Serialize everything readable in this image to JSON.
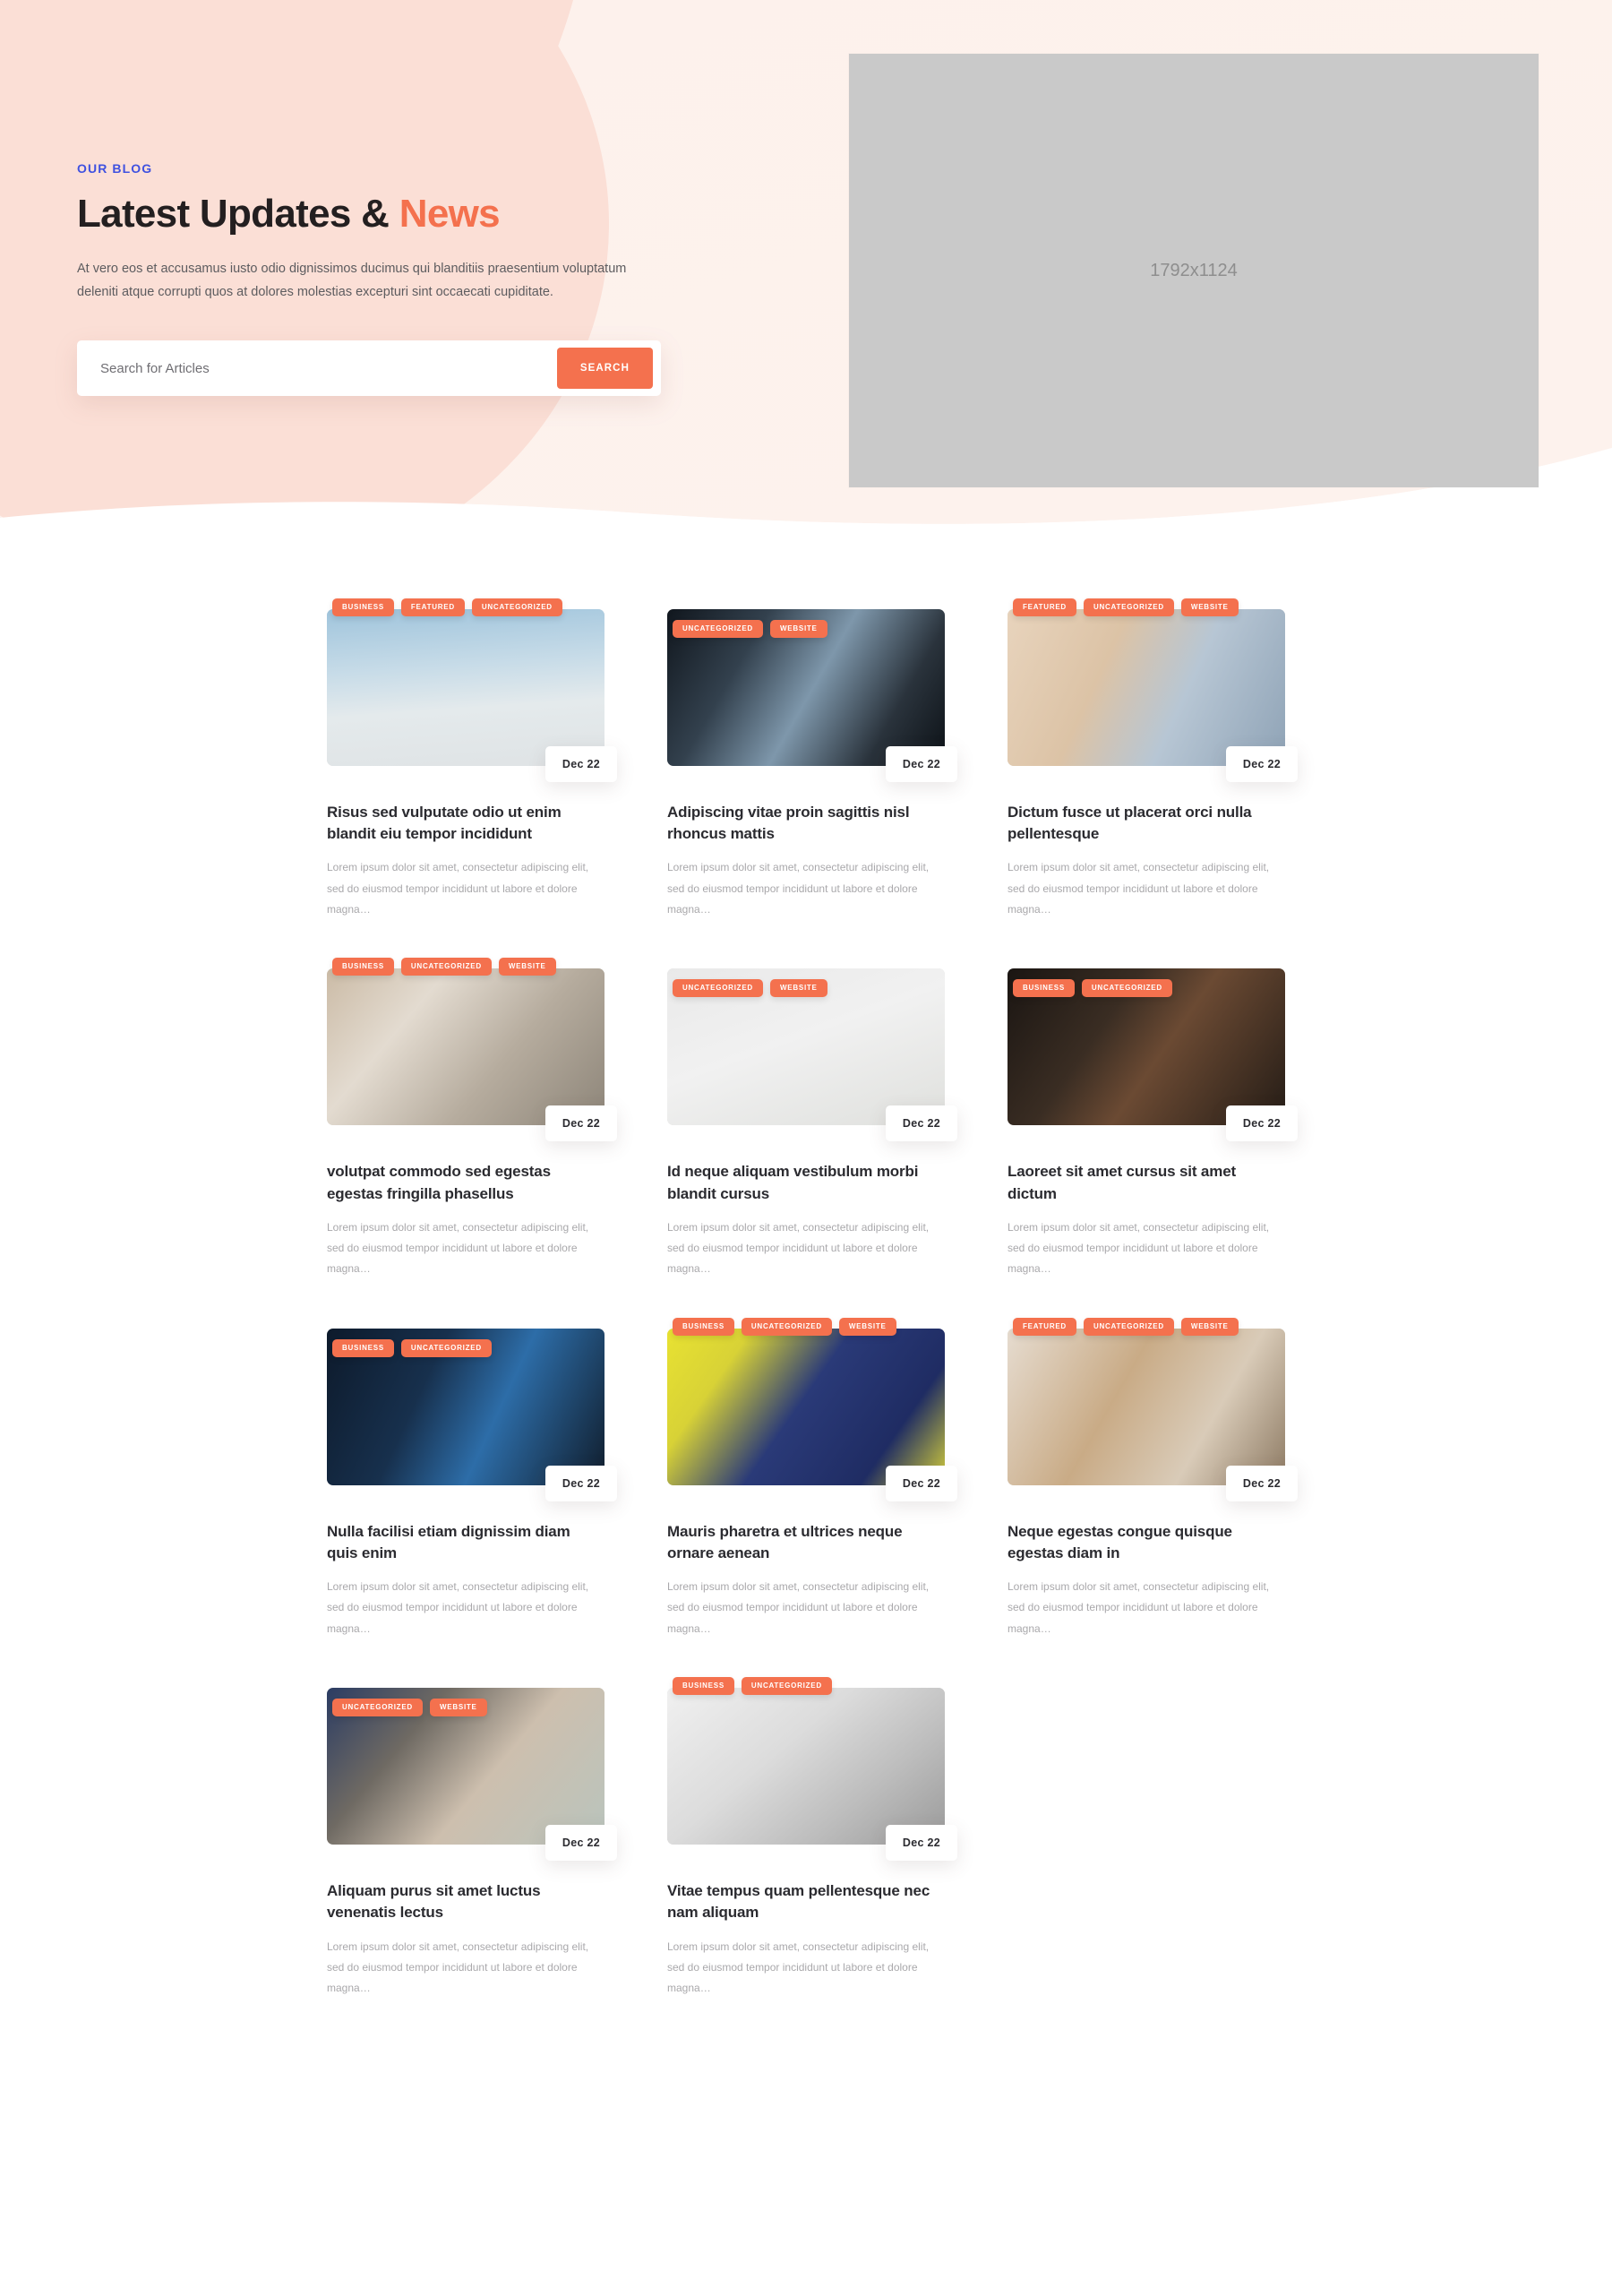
{
  "hero": {
    "eyebrow": "OUR BLOG",
    "title_main": "Latest Updates & ",
    "title_accent": "News",
    "subtitle": "At vero eos et accusamus iusto odio dignissimos ducimus qui blanditiis praesentium voluptatum deleniti atque corrupti quos at dolores molestias excepturi sint occaecati cupiditate.",
    "search_placeholder": "Search for Articles",
    "search_value": "",
    "search_button": "SEARCH",
    "image_placeholder_label": "1792x1124",
    "colors": {
      "accent": "#f4714e",
      "eyebrow": "#3f51e0",
      "hero_bg_light": "#fdf0eb",
      "hero_bg_blob": "#fbdfd6",
      "heading": "#231f20",
      "body_text": "#5d5c5f",
      "placeholder_bg": "#c9c9c9"
    }
  },
  "posts": [
    {
      "tags": [
        "BUSINESS",
        "FEATURED",
        "UNCATEGORIZED"
      ],
      "tags_overhang": true,
      "date": "Dec 22",
      "title": "Risus sed vulputate odio ut enim blandit eiu tempor incididunt",
      "excerpt": "Lorem ipsum dolor sit amet, consectetur adipiscing elit, sed do eiusmod tempor incididunt ut labore et dolore magna…",
      "image": "p-clouds",
      "column": 0
    },
    {
      "tags": [
        "UNCATEGORIZED",
        "WEBSITE"
      ],
      "tags_overhang": false,
      "date": "Dec 22",
      "title": "Adipiscing vitae proin sagittis nisl rhoncus mattis",
      "excerpt": "Lorem ipsum dolor sit amet, consectetur adipiscing elit, sed do eiusmod tempor incididunt ut labore et dolore magna…",
      "image": "p-towers",
      "column": 1
    },
    {
      "tags": [
        "FEATURED",
        "UNCATEGORIZED",
        "WEBSITE"
      ],
      "tags_overhang": true,
      "date": "Dec 22",
      "title": "Dictum fusce ut placerat orci nulla pellentesque",
      "excerpt": "Lorem ipsum dolor sit amet, consectetur adipiscing elit, sed do eiusmod tempor incididunt ut labore et dolore magna…",
      "image": "p-tablet",
      "column": 2
    },
    {
      "tags": [
        "BUSINESS",
        "UNCATEGORIZED",
        "WEBSITE"
      ],
      "tags_overhang": true,
      "date": "Dec 22",
      "title": "volutpat commodo sed egestas egestas fringilla phasellus",
      "excerpt": "Lorem ipsum dolor sit amet, consectetur adipiscing elit, sed do eiusmod tempor incididunt ut labore et dolore magna…",
      "image": "p-desk",
      "column": 0
    },
    {
      "tags": [
        "UNCATEGORIZED",
        "WEBSITE"
      ],
      "tags_overhang": false,
      "date": "Dec 22",
      "title": "Id neque aliquam vestibulum morbi blandit cursus",
      "excerpt": "Lorem ipsum dolor sit amet, consectetur adipiscing elit, sed do eiusmod tempor incididunt ut labore et dolore magna…",
      "image": "p-flat",
      "column": 1
    },
    {
      "tags": [
        "BUSINESS",
        "UNCATEGORIZED"
      ],
      "tags_overhang": false,
      "date": "Dec 22",
      "title": "Laoreet sit amet cursus sit amet dictum",
      "excerpt": "Lorem ipsum dolor sit amet, consectetur adipiscing elit, sed do eiusmod tempor incididunt ut labore et dolore magna…",
      "image": "p-dark",
      "column": 2
    },
    {
      "tags": [
        "BUSINESS",
        "UNCATEGORIZED"
      ],
      "tags_overhang": false,
      "date": "Dec 22",
      "title": "Nulla facilisi etiam dignissim diam quis enim",
      "excerpt": "Lorem ipsum dolor sit amet, consectetur adipiscing elit, sed do eiusmod tempor incididunt ut labore et dolore magna…",
      "image": "p-server",
      "column": 0
    },
    {
      "tags": [
        "BUSINESS",
        "UNCATEGORIZED",
        "WEBSITE"
      ],
      "tags_overhang": true,
      "date": "Dec 22",
      "title": "Mauris pharetra et ultrices neque ornare aenean",
      "excerpt": "Lorem ipsum dolor sit amet, consectetur adipiscing elit, sed do eiusmod tempor incididunt ut labore et dolore magna…",
      "image": "p-phone",
      "column": 1
    },
    {
      "tags": [
        "FEATURED",
        "UNCATEGORIZED",
        "WEBSITE"
      ],
      "tags_overhang": true,
      "date": "Dec 22",
      "title": "Neque egestas congue quisque egestas diam in",
      "excerpt": "Lorem ipsum dolor sit amet, consectetur adipiscing elit, sed do eiusmod tempor incididunt ut labore et dolore magna…",
      "image": "p-laptop",
      "column": 2
    },
    {
      "tags": [
        "UNCATEGORIZED",
        "WEBSITE"
      ],
      "tags_overhang": false,
      "date": "Dec 22",
      "title": "Aliquam purus sit amet luctus venenatis lectus",
      "excerpt": "Lorem ipsum dolor sit amet, consectetur adipiscing elit, sed do eiusmod tempor incididunt ut labore et dolore magna…",
      "image": "p-woman",
      "column": 0
    },
    {
      "tags": [
        "BUSINESS",
        "UNCATEGORIZED"
      ],
      "tags_overhang": true,
      "date": "Dec 22",
      "title": "Vitae tempus quam pellentesque nec nam aliquam",
      "excerpt": "Lorem ipsum dolor sit amet, consectetur adipiscing elit, sed do eiusmod tempor incididunt ut labore et dolore magna…",
      "image": "p-workdesk",
      "column": 1
    }
  ]
}
